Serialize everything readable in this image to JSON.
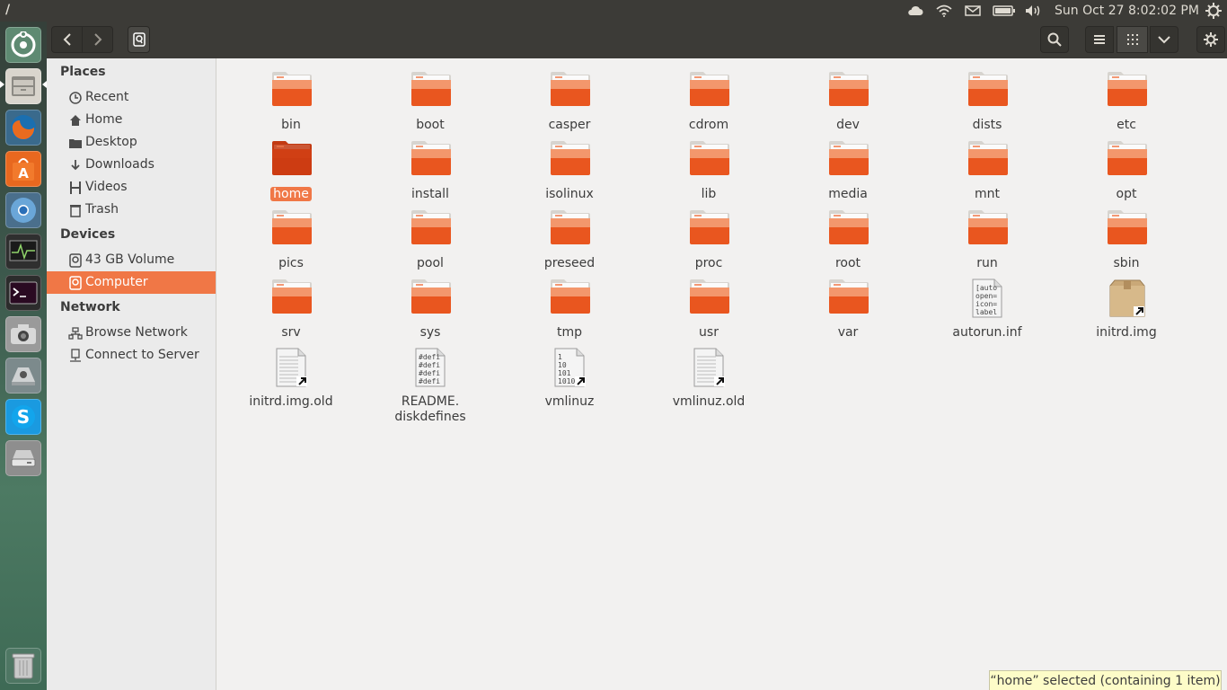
{
  "panel": {
    "title": "/",
    "date": "Sun Oct 27",
    "time": "8:02:02 PM"
  },
  "launcher": {
    "items": [
      {
        "name": "dash-home-icon"
      },
      {
        "name": "files-icon"
      },
      {
        "name": "firefox-icon"
      },
      {
        "name": "software-center-icon"
      },
      {
        "name": "chromium-icon"
      },
      {
        "name": "system-monitor-icon"
      },
      {
        "name": "terminal-icon"
      },
      {
        "name": "camera-icon"
      },
      {
        "name": "installer-icon"
      },
      {
        "name": "skype-icon"
      },
      {
        "name": "drive-icon"
      },
      {
        "name": "trash-icon"
      }
    ]
  },
  "sidebar": {
    "places_heading": "Places",
    "places": [
      {
        "label": "Recent",
        "icon": "clock-icon"
      },
      {
        "label": "Home",
        "icon": "home-icon"
      },
      {
        "label": "Desktop",
        "icon": "folder-icon"
      },
      {
        "label": "Downloads",
        "icon": "download-icon"
      },
      {
        "label": "Videos",
        "icon": "film-icon"
      },
      {
        "label": "Trash",
        "icon": "trash-icon"
      }
    ],
    "devices_heading": "Devices",
    "devices": [
      {
        "label": "43 GB Volume",
        "icon": "drive-icon"
      },
      {
        "label": "Computer",
        "icon": "drive-icon"
      }
    ],
    "network_heading": "Network",
    "network": [
      {
        "label": "Browse Network",
        "icon": "network-icon"
      },
      {
        "label": "Connect to Server",
        "icon": "server-icon"
      }
    ]
  },
  "files": [
    {
      "name": "bin",
      "type": "folder"
    },
    {
      "name": "boot",
      "type": "folder"
    },
    {
      "name": "casper",
      "type": "folder"
    },
    {
      "name": "cdrom",
      "type": "folder"
    },
    {
      "name": "dev",
      "type": "folder"
    },
    {
      "name": "dists",
      "type": "folder"
    },
    {
      "name": "etc",
      "type": "folder"
    },
    {
      "name": "home",
      "type": "folder-selected"
    },
    {
      "name": "install",
      "type": "folder"
    },
    {
      "name": "isolinux",
      "type": "folder"
    },
    {
      "name": "lib",
      "type": "folder"
    },
    {
      "name": "media",
      "type": "folder"
    },
    {
      "name": "mnt",
      "type": "folder"
    },
    {
      "name": "opt",
      "type": "folder"
    },
    {
      "name": "pics",
      "type": "folder"
    },
    {
      "name": "pool",
      "type": "folder"
    },
    {
      "name": "preseed",
      "type": "folder"
    },
    {
      "name": "proc",
      "type": "folder"
    },
    {
      "name": "root",
      "type": "folder"
    },
    {
      "name": "run",
      "type": "folder"
    },
    {
      "name": "sbin",
      "type": "folder"
    },
    {
      "name": "srv",
      "type": "folder"
    },
    {
      "name": "sys",
      "type": "folder"
    },
    {
      "name": "tmp",
      "type": "folder"
    },
    {
      "name": "usr",
      "type": "folder"
    },
    {
      "name": "var",
      "type": "folder"
    },
    {
      "name": "autorun.inf",
      "type": "text",
      "preview": [
        "[auto",
        "open=",
        "icon=",
        "label"
      ]
    },
    {
      "name": "initrd.img",
      "type": "package-link"
    },
    {
      "name": "initrd.img.old",
      "type": "doc-link"
    },
    {
      "name": "README.\ndiskdefines",
      "type": "text",
      "preview": [
        "#defi",
        "#defi",
        "#defi",
        "#defi"
      ]
    },
    {
      "name": "vmlinuz",
      "type": "binary-link",
      "preview": [
        "1",
        "10",
        "101",
        "1010"
      ]
    },
    {
      "name": "vmlinuz.old",
      "type": "doc-link"
    }
  ],
  "status": {
    "text": "“home” selected  (containing 1 item)"
  },
  "colors": {
    "accent": "#f07746",
    "folder_top": "#f4a27a",
    "folder_body": "#e9561f",
    "panel": "#3c3b37"
  }
}
